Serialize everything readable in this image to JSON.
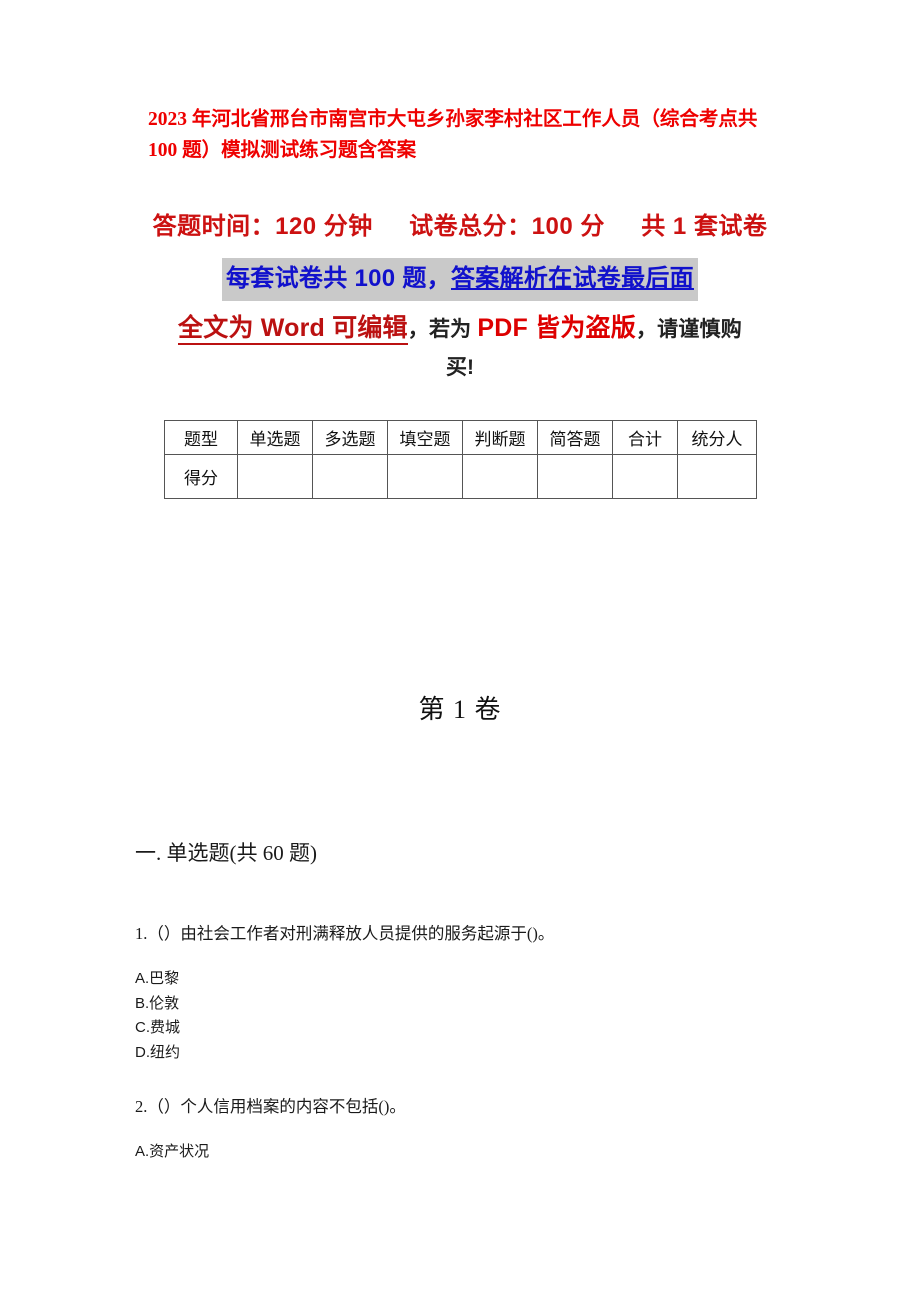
{
  "document": {
    "title": "2023 年河北省邢台市南宫市大屯乡孙家李村社区工作人员（综合考点共 100 题）模拟测试练习题含答案",
    "info": {
      "time_label": "答题时间：120 分钟",
      "total_score_label": "试卷总分：100 分",
      "set_count_label": "共 1 套试卷",
      "highlight_prefix": "每套试卷共 100 题，",
      "highlight_link": "答案解析在试卷最后面",
      "notice_word_editable": "全文为 Word 可编辑",
      "notice_mid": "，若为 ",
      "notice_pdf_pirated": "PDF 皆为盗版",
      "notice_tail": "，请谨慎购",
      "notice_last_line": "买!"
    },
    "score_table": {
      "headers": [
        "题型",
        "单选题",
        "多选题",
        "填空题",
        "判断题",
        "简答题",
        "合计",
        "统分人"
      ],
      "rows": [
        {
          "label": "得分",
          "cells": [
            "",
            "",
            "",
            "",
            "",
            "",
            ""
          ]
        }
      ]
    },
    "volume_heading": "第 1 卷",
    "sections": [
      {
        "heading": "一. 单选题(共 60 题)",
        "questions": [
          {
            "stem": "1.（）由社会工作者对刑满释放人员提供的服务起源于()。",
            "options": [
              "A.巴黎",
              "B.伦敦",
              "C.费城",
              "D.纽约"
            ]
          },
          {
            "stem": "2.（）个人信用档案的内容不包括()。",
            "options": [
              "A.资产状况"
            ]
          }
        ]
      }
    ],
    "colors": {
      "title_red": "#ee0000",
      "info_red": "#cc1111",
      "highlight_blue": "#1111cc",
      "highlight_bg": "#c9c9c9",
      "word_red": "#bb1111",
      "pdf_red": "#dd0000",
      "text_dark": "#1a1a1a",
      "table_border": "#555555"
    }
  }
}
